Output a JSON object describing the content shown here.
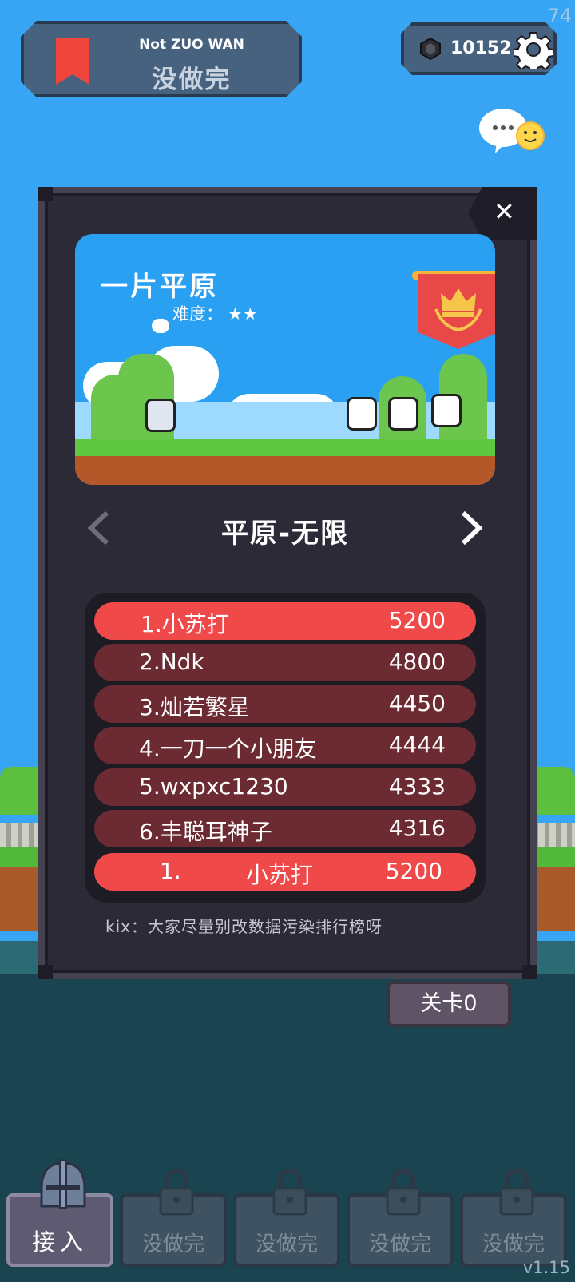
{
  "hud": {
    "mode_subtitle": "Not ZUO WAN",
    "mode_title": "没做完",
    "currency": "10152",
    "fps": "74"
  },
  "stage": {
    "name": "一片平原",
    "difficulty_label": "难度：",
    "difficulty_stars": "★★",
    "mode_name": "平原-无限"
  },
  "leaderboard": {
    "rows": [
      {
        "rank_name": "1.小苏打",
        "score": "5200"
      },
      {
        "rank_name": "2.Ndk",
        "score": "4800"
      },
      {
        "rank_name": "3.灿若繁星",
        "score": "4450"
      },
      {
        "rank_name": "4.一刀一个小朋友",
        "score": "4444"
      },
      {
        "rank_name": "5.wxpxc1230",
        "score": "4333"
      },
      {
        "rank_name": "6.丰聪耳神子",
        "score": "4316"
      }
    ],
    "mine": {
      "rank": "1.",
      "name": "小苏打",
      "score": "5200"
    },
    "notice": "kix：大家尽量别改数据污染排行榜呀"
  },
  "level_button": "关卡0",
  "tabs": [
    {
      "label": "接入",
      "icon": "helmet-icon"
    },
    {
      "label": "没做完",
      "icon": "lock-icon"
    },
    {
      "label": "没做完",
      "icon": "lock-icon"
    },
    {
      "label": "没做完",
      "icon": "lock-icon"
    },
    {
      "label": "没做完",
      "icon": "lock-icon"
    }
  ],
  "version": "v1.15",
  "colors": {
    "sky": "#37a5f4",
    "panel": "#2d2a37",
    "row_highlight": "#f0494a",
    "row_normal": "#6c2a32"
  }
}
